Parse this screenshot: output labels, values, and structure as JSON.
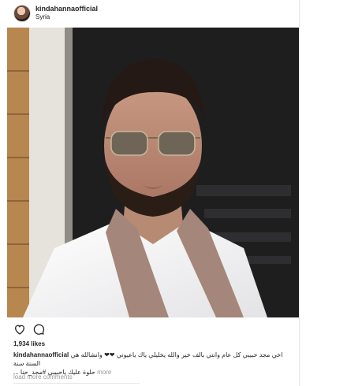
{
  "post": {
    "username": "kindahannaofficial",
    "location": "Syria",
    "likes": "1,934 likes",
    "caption_user": "kindahannaofficial",
    "caption_line1": "اخي مجد حبيبي كل عام وانتي بالف خير والله يخليلي ياك ياعيوني ❤❤ وانشالله هي السنة سنة",
    "caption_line2": "حلوة عليك ياحبيبي #مجد_حنا ...",
    "more_label": "more",
    "load_more": "load more comments"
  },
  "icons": {
    "like": "heart-icon",
    "comment": "comment-icon"
  },
  "colors": {
    "text": "#262626",
    "muted": "#999999",
    "border": "#e6e6e6"
  }
}
